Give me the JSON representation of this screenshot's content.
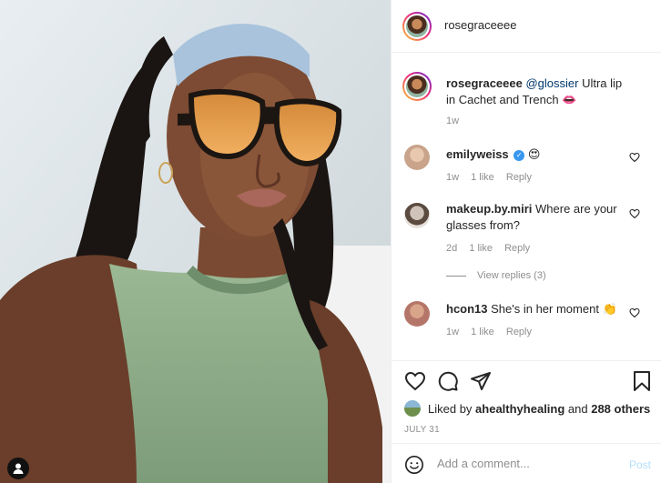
{
  "post": {
    "username": "rosegraceeee",
    "caption_user": "rosegraceeee",
    "caption_mention": "@glossier",
    "caption_text": " Ultra lip in Cachet and Trench ",
    "caption_emoji": "👄",
    "caption_time": "1w"
  },
  "comments": [
    {
      "user": "emilyweiss",
      "verified": true,
      "text": "",
      "emoji": "😍",
      "time": "1w",
      "likes": "1 like",
      "reply": "Reply"
    },
    {
      "user": "makeup.by.miri",
      "verified": false,
      "text": " Where are your glasses from?",
      "emoji": "",
      "time": "2d",
      "likes": "1 like",
      "reply": "Reply"
    },
    {
      "user": "hcon13",
      "verified": false,
      "text": " She's in her moment ",
      "emoji": "👏",
      "time": "1w",
      "likes": "1 like",
      "reply": "Reply"
    }
  ],
  "view_replies": "View replies (3)",
  "likes": {
    "prefix": "Liked by ",
    "user": "ahealthyhealing",
    "middle": " and ",
    "others": "288 others"
  },
  "date": "JULY 31",
  "add_comment": {
    "placeholder": "Add a comment...",
    "post_label": "Post"
  },
  "icons": [
    "heart-icon",
    "comment-icon",
    "share-icon",
    "bookmark-icon",
    "smile-icon",
    "tag-person-icon"
  ],
  "colors": {
    "link": "#00376b",
    "muted": "#8e8e8e",
    "post_disabled": "#b2dffc",
    "verified": "#3897f0"
  }
}
